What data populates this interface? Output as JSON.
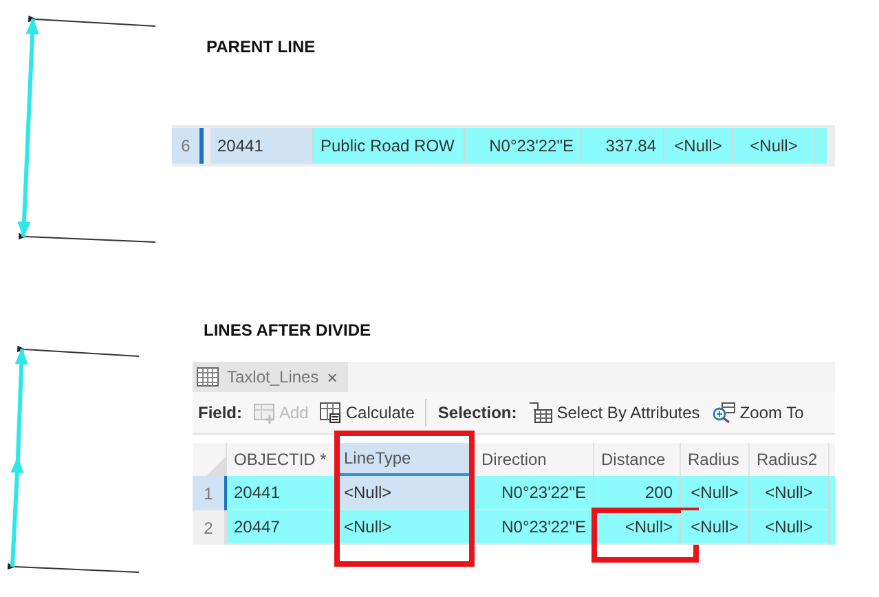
{
  "parent_line": {
    "title": "PARENT LINE",
    "row": {
      "number": "6",
      "selected": true,
      "cells": [
        {
          "text": "20441",
          "active": true
        },
        {
          "text": "Public Road ROW",
          "active": false
        },
        {
          "text": "N0°23'22\"E",
          "active": false
        },
        {
          "text": "337.84",
          "active": false
        },
        {
          "text": "<Null>",
          "active": false
        },
        {
          "text": "<Null>",
          "active": false
        }
      ]
    }
  },
  "lines_after_divide": {
    "title": "LINES AFTER DIVIDE",
    "tab": {
      "label": "Taxlot_Lines",
      "close": "×"
    },
    "toolbar": [
      {
        "kind": "label",
        "text": "Field:"
      },
      {
        "kind": "button",
        "text": "Add",
        "disabled": true
      },
      {
        "kind": "button",
        "text": "Calculate",
        "disabled": false
      },
      {
        "kind": "separator"
      },
      {
        "kind": "label",
        "text": "Selection:"
      },
      {
        "kind": "button",
        "text": "Select By Attributes",
        "disabled": false
      },
      {
        "kind": "button",
        "text": "Zoom To",
        "disabled": false
      }
    ],
    "columns": [
      {
        "label": "OBJECTID *",
        "selected": false,
        "framed": false
      },
      {
        "label": "LineType",
        "selected": true,
        "framed": true
      },
      {
        "label": "Direction",
        "selected": false,
        "framed": false
      },
      {
        "label": "Distance",
        "selected": false,
        "framed": false
      },
      {
        "label": "Radius",
        "selected": false,
        "framed": false
      },
      {
        "label": "Radius2",
        "selected": false,
        "framed": false
      }
    ],
    "rows": [
      {
        "number": "1",
        "selected": true,
        "cells": [
          {
            "text": "20441",
            "active": false,
            "framed": false
          },
          {
            "text": "<Null>",
            "active": true,
            "framed": false
          },
          {
            "text": "N0°23'22\"E",
            "active": false,
            "framed": false
          },
          {
            "text": "200",
            "active": false,
            "framed": false
          },
          {
            "text": "<Null>",
            "active": false,
            "framed": false
          },
          {
            "text": "<Null>",
            "active": false,
            "framed": false
          }
        ]
      },
      {
        "number": "2",
        "selected": false,
        "cells": [
          {
            "text": "20447",
            "active": false,
            "framed": false
          },
          {
            "text": "<Null>",
            "active": false,
            "framed": false
          },
          {
            "text": "N0°23'22\"E",
            "active": false,
            "framed": false
          },
          {
            "text": "<Null>",
            "active": false,
            "framed": true
          },
          {
            "text": "<Null>",
            "active": false,
            "framed": false
          },
          {
            "text": "<Null>",
            "active": false,
            "framed": false
          }
        ]
      }
    ]
  }
}
